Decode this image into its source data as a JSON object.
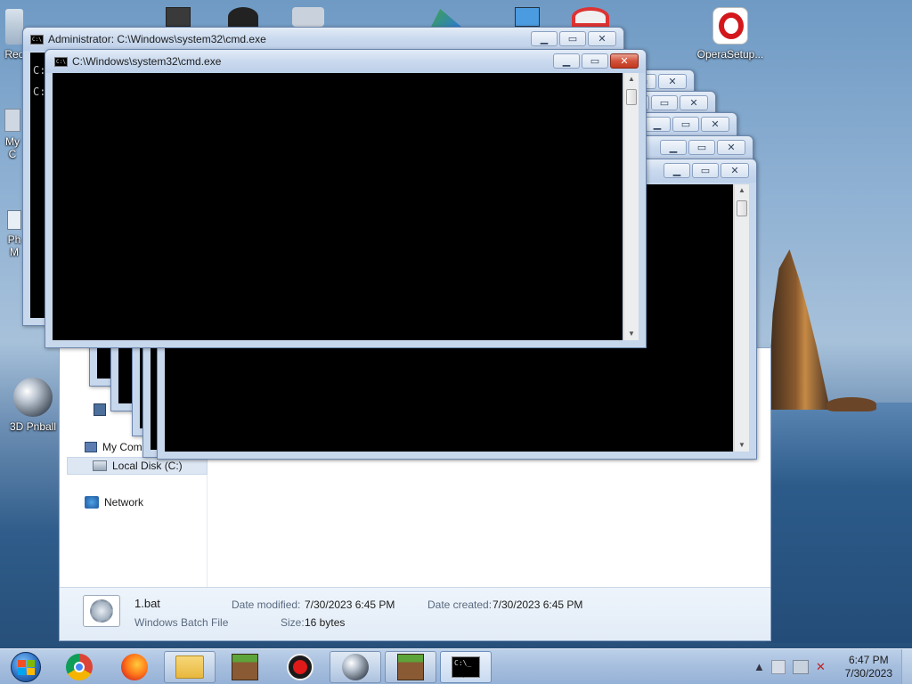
{
  "desktop": {
    "icons": {
      "recycle_bin": "Rec",
      "my_computer": "My C",
      "photos": "Ph",
      "photos_2": "M",
      "pinball": "3D Pnball",
      "opera": "OperaSetup..."
    }
  },
  "windows": {
    "admin_cmd": {
      "title": "Administrator: C:\\Windows\\system32\\cmd.exe",
      "line1": "C:",
      "line2": "C:"
    },
    "front_cmd": {
      "title": "C:\\Windows\\system32\\cmd.exe"
    },
    "controls": {
      "minimize": "▁",
      "maximize": "▭",
      "close": "✕"
    }
  },
  "explorer": {
    "nav": {
      "my_computer": "My Compu",
      "local_disk": "Local Disk (C:)",
      "network": "Network"
    },
    "details": {
      "filename": "1.bat",
      "filetype": "Windows Batch File",
      "date_modified_label": "Date modified:",
      "date_modified_value": "7/30/2023 6:45 PM",
      "date_created_label": "Date created:",
      "date_created_value": "7/30/2023 6:45 PM",
      "size_label": "Size:",
      "size_value": "16 bytes"
    }
  },
  "taskbar": {
    "clock_time": "6:47 PM",
    "clock_date": "7/30/2023",
    "cmd_icon_text": "C:\\_"
  },
  "colors": {
    "console_bg": "#000000",
    "title_bar": "#c9d9ee",
    "close_red": "#c2381f"
  }
}
